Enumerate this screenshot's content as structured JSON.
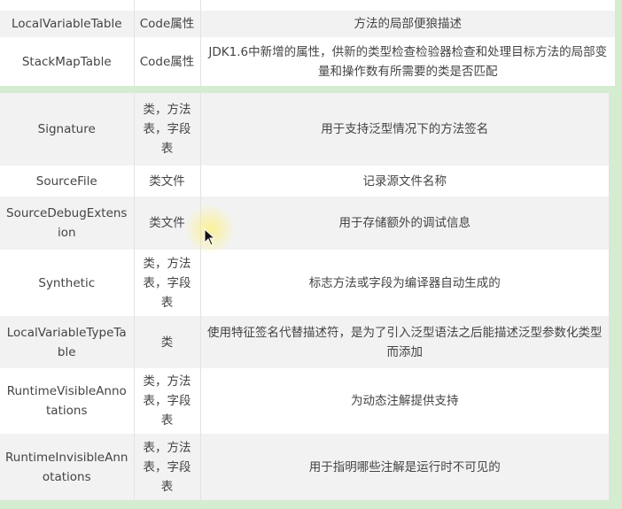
{
  "table_top": {
    "rows": [
      {
        "name": "",
        "scope": "",
        "desc": ""
      },
      {
        "name": "LocalVariableTable",
        "scope": "Code属性",
        "desc": "方法的局部便狼描述"
      },
      {
        "name": "StackMapTable",
        "scope": "Code属性",
        "desc": "JDK1.6中新增的属性，供新的类型检查检验器检查和处理目标方法的局部变量和操作数有所需要的类是否匹配"
      }
    ]
  },
  "table_bottom": {
    "rows": [
      {
        "name": "Signature",
        "scope": "类，方法表，字段表",
        "desc": "用于支持泛型情况下的方法签名"
      },
      {
        "name": "SourceFile",
        "scope": "类文件",
        "desc": "记录源文件名称"
      },
      {
        "name": "SourceDebugExtension",
        "scope": "类文件",
        "desc": "用于存储额外的调试信息"
      },
      {
        "name": "Synthetic",
        "scope": "类，方法表，字段表",
        "desc": "标志方法或字段为编译器自动生成的"
      },
      {
        "name": "LocalVariableTypeTable",
        "scope": "类",
        "desc": "使用特征签名代替描述符，是为了引入泛型语法之后能描述泛型参数化类型而添加"
      },
      {
        "name": "RuntimeVisibleAnnotations",
        "scope": "类，方法表，字段表",
        "desc": "为动态注解提供支持"
      },
      {
        "name": "RuntimeInvisibleAnnotations",
        "scope": "表，方法表，字段表",
        "desc": "用于指明哪些注解是运行时不可见的"
      }
    ]
  },
  "colors": {
    "background_green": "#d4ecd0",
    "row_grey": "#f2f2f2"
  }
}
